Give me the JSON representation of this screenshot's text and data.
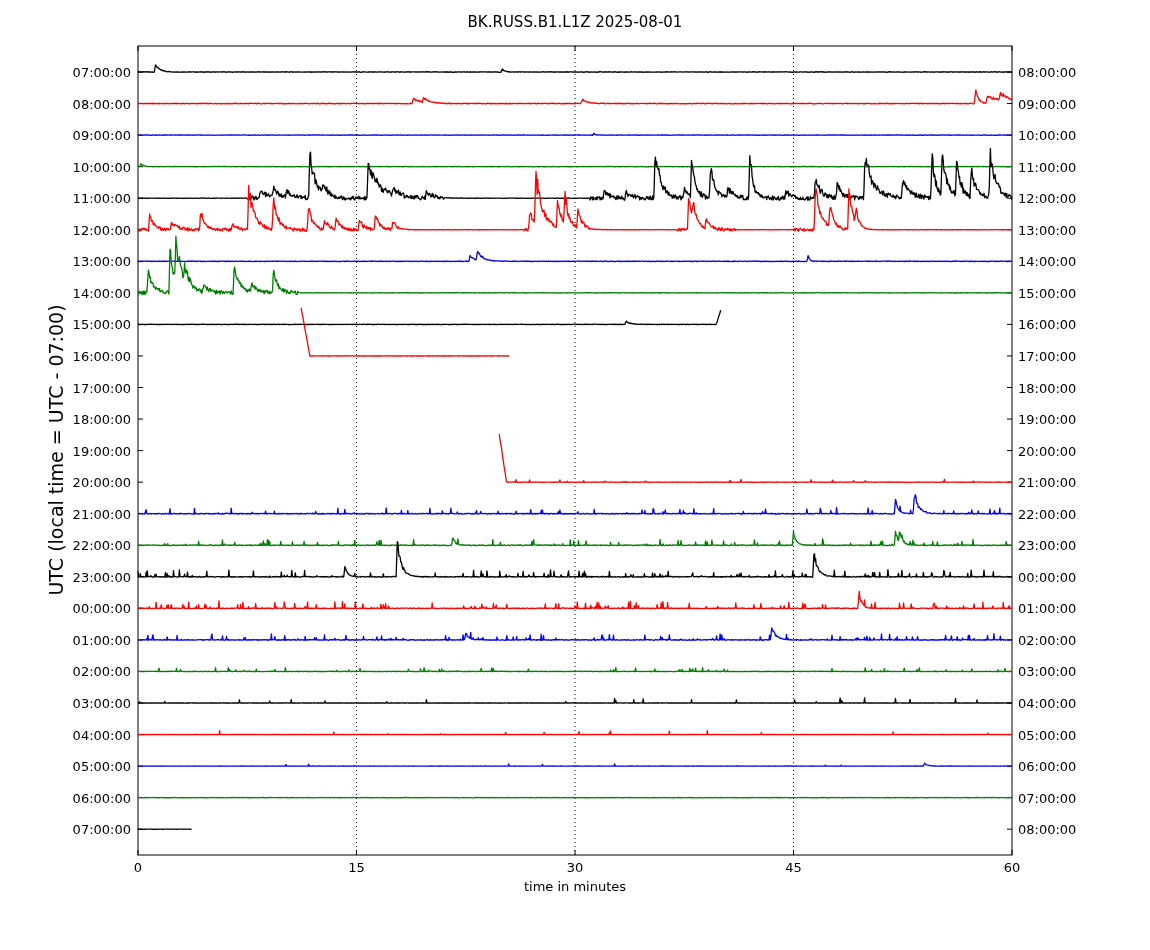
{
  "title": "BK.RUSS.B1.L1Z 2025-08-01",
  "ylabel": "UTC (local time = UTC - 07:00)",
  "xlabel": "time in minutes",
  "xticks": [
    "0",
    "15",
    "30",
    "45",
    "60"
  ],
  "rows": [
    {
      "left": "07:00:00",
      "right": "08:00:00",
      "color": "#000000"
    },
    {
      "left": "08:00:00",
      "right": "09:00:00",
      "color": "#ff0000"
    },
    {
      "left": "09:00:00",
      "right": "10:00:00",
      "color": "#0000ff"
    },
    {
      "left": "10:00:00",
      "right": "11:00:00",
      "color": "#008000"
    },
    {
      "left": "11:00:00",
      "right": "12:00:00",
      "color": "#000000"
    },
    {
      "left": "12:00:00",
      "right": "13:00:00",
      "color": "#ff0000"
    },
    {
      "left": "13:00:00",
      "right": "14:00:00",
      "color": "#0000ff"
    },
    {
      "left": "14:00:00",
      "right": "15:00:00",
      "color": "#008000"
    },
    {
      "left": "15:00:00",
      "right": "16:00:00",
      "color": "#000000"
    },
    {
      "left": "16:00:00",
      "right": "17:00:00",
      "color": "#ff0000"
    },
    {
      "left": "17:00:00",
      "right": "18:00:00"
    },
    {
      "left": "18:00:00",
      "right": "19:00:00"
    },
    {
      "left": "19:00:00",
      "right": "20:00:00"
    },
    {
      "left": "20:00:00",
      "right": "21:00:00",
      "color": "#ff0000"
    },
    {
      "left": "21:00:00",
      "right": "22:00:00",
      "color": "#0000ff"
    },
    {
      "left": "22:00:00",
      "right": "23:00:00",
      "color": "#008000"
    },
    {
      "left": "23:00:00",
      "right": "00:00:00",
      "color": "#000000"
    },
    {
      "left": "00:00:00",
      "right": "01:00:00",
      "color": "#ff0000"
    },
    {
      "left": "01:00:00",
      "right": "02:00:00",
      "color": "#0000ff"
    },
    {
      "left": "02:00:00",
      "right": "03:00:00",
      "color": "#008000"
    },
    {
      "left": "03:00:00",
      "right": "04:00:00",
      "color": "#000000"
    },
    {
      "left": "04:00:00",
      "right": "05:00:00",
      "color": "#ff0000"
    },
    {
      "left": "05:00:00",
      "right": "06:00:00",
      "color": "#0000ff"
    },
    {
      "left": "06:00:00",
      "right": "07:00:00",
      "color": "#008000"
    },
    {
      "left": "07:00:00",
      "right": "08:00:00",
      "color": "#000000"
    }
  ]
}
